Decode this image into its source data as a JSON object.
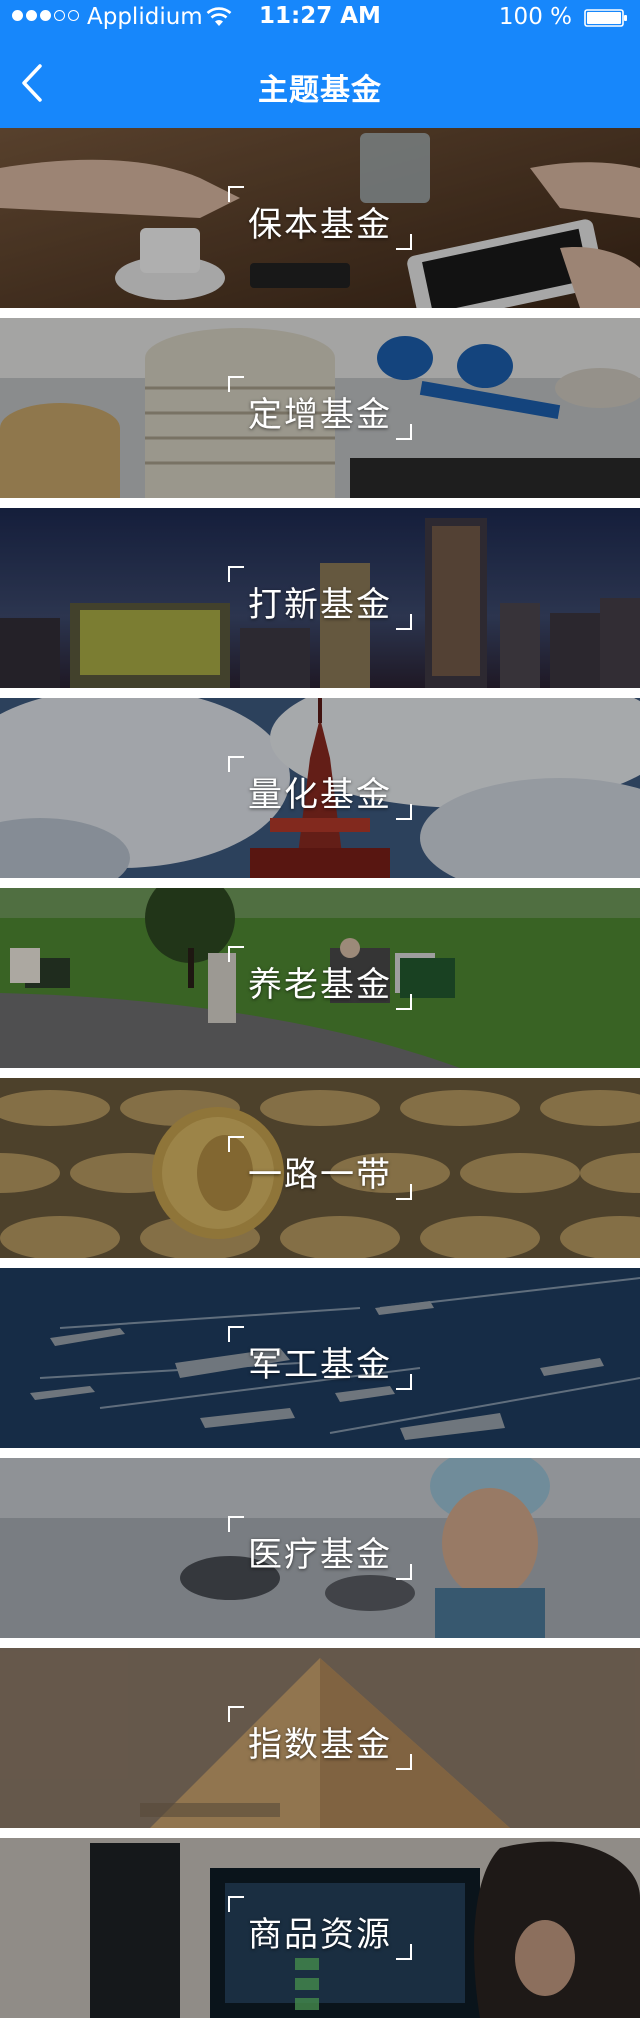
{
  "status_bar": {
    "carrier": "Applidium",
    "time": "11:27 AM",
    "battery": "100 %"
  },
  "nav": {
    "title": "主题基金",
    "back_icon": "chevron-left-icon"
  },
  "colors": {
    "accent": "#1787fb",
    "label": "#ffffff"
  },
  "categories": [
    {
      "label": "保本基金"
    },
    {
      "label": "定增基金"
    },
    {
      "label": "打新基金"
    },
    {
      "label": "量化基金"
    },
    {
      "label": "养老基金"
    },
    {
      "label": "一路一带"
    },
    {
      "label": "军工基金"
    },
    {
      "label": "医疗基金"
    },
    {
      "label": "指数基金"
    },
    {
      "label": "商品资源"
    }
  ]
}
